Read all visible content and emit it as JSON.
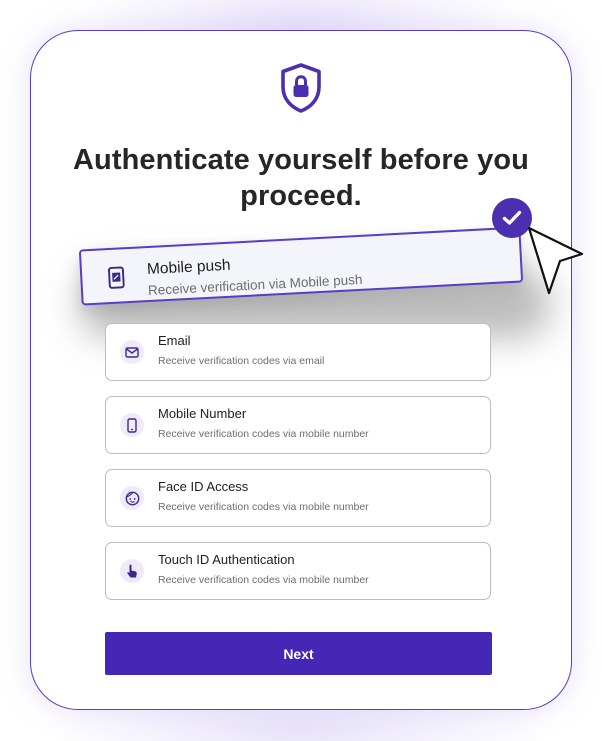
{
  "heading": "Authenticate yourself before you proceed.",
  "selected_option": {
    "title": "Mobile push",
    "description": "Receive verification via Mobile push",
    "icon": "mobile-push-icon"
  },
  "options": [
    {
      "title": "Email",
      "description": "Receive verification codes via email",
      "icon": "mail-icon"
    },
    {
      "title": "Mobile Number",
      "description": "Receive verification codes via mobile number",
      "icon": "phone-icon"
    },
    {
      "title": "Face ID Access",
      "description": "Receive verification codes via mobile number",
      "icon": "face-id-icon"
    },
    {
      "title": "Touch ID Authentication",
      "description": "Receive verification codes via mobile number",
      "icon": "touch-icon"
    }
  ],
  "next_label": "Next",
  "colors": {
    "accent": "#4527b5",
    "accent_light": "#eeeaf9",
    "border": "#bdbdbd",
    "text_dark": "#262626",
    "text_muted": "#6d6d6d"
  }
}
